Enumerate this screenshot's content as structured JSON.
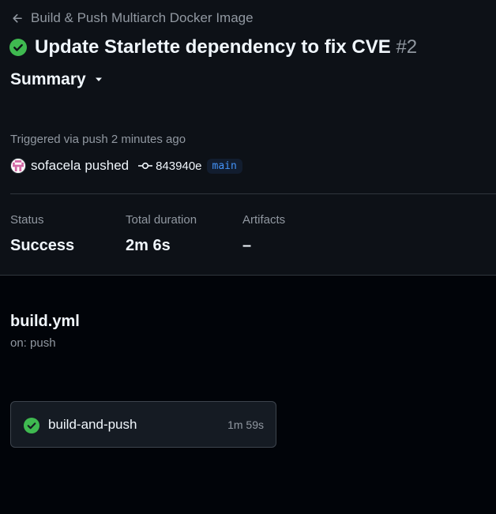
{
  "header": {
    "back_label": "Build & Push Multiarch Docker Image",
    "run_title": "Update Starlette dependency to fix CVE",
    "run_number": "#2",
    "status_color": "#3fb950"
  },
  "summary": {
    "label": "Summary"
  },
  "trigger": {
    "text": "Triggered via push 2 minutes ago",
    "actor": "sofacela",
    "action": "pushed",
    "commit_sha": "843940e",
    "branch": "main"
  },
  "stats": {
    "status_label": "Status",
    "status_value": "Success",
    "duration_label": "Total duration",
    "duration_value": "2m 6s",
    "artifacts_label": "Artifacts",
    "artifacts_value": "–"
  },
  "workflow": {
    "file": "build.yml",
    "on": "on: push",
    "jobs": [
      {
        "name": "build-and-push",
        "duration": "1m 59s",
        "status": "success"
      }
    ]
  },
  "icons": {
    "back": "arrow-left-icon",
    "status": "check-circle-icon",
    "dropdown": "triangle-down-icon",
    "commit": "git-commit-icon"
  }
}
